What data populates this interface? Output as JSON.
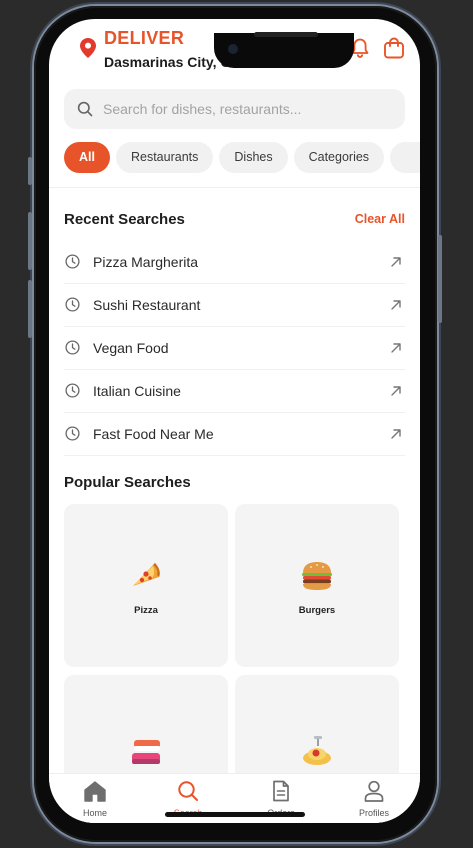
{
  "header": {
    "deliver_label": "DELIVER",
    "location": "Dasmarinas City, Cavite"
  },
  "search": {
    "placeholder": "Search for dishes, restaurants..."
  },
  "chips": [
    "All",
    "Restaurants",
    "Dishes",
    "Categories"
  ],
  "recent": {
    "title": "Recent Searches",
    "clear_label": "Clear All",
    "items": [
      "Pizza Margherita",
      "Sushi Restaurant",
      "Vegan Food",
      "Italian Cuisine",
      "Fast Food Near Me"
    ]
  },
  "popular": {
    "title": "Popular Searches",
    "items": [
      "Pizza",
      "Burgers",
      "",
      ""
    ]
  },
  "nav": [
    "Home",
    "Search",
    "Orders",
    "Profiles"
  ],
  "colors": {
    "accent": "#e8542a",
    "chip_bg": "#f1f1f1",
    "card_bg": "#f4f4f4"
  }
}
